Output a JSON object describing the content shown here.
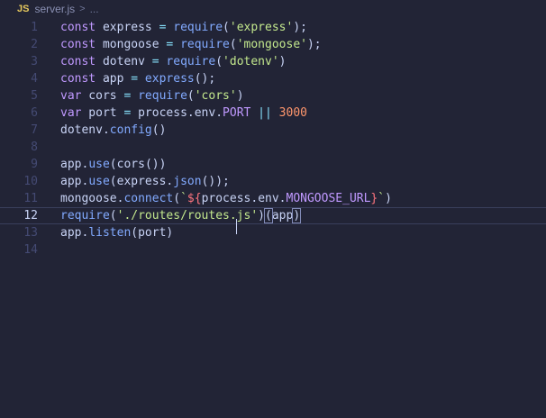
{
  "breadcrumb": {
    "lang_badge": "JS",
    "file": "server.js",
    "separator": ">",
    "more": "..."
  },
  "colors": {
    "background": "#222436",
    "keyword": "#c099ff",
    "function": "#82aaff",
    "string": "#c3e88d",
    "operator": "#86e1fc",
    "property": "#4fd6be",
    "number": "#ff966c",
    "line_number": "#444a73"
  },
  "editor": {
    "active_line": 12,
    "lines": [
      {
        "n": "1",
        "tokens": [
          [
            "kw",
            "const"
          ],
          [
            "var",
            " express "
          ],
          [
            "op",
            "="
          ],
          [
            "fn",
            " require"
          ],
          [
            "punc",
            "("
          ],
          [
            "str",
            "'express'"
          ],
          [
            "punc",
            ");"
          ]
        ]
      },
      {
        "n": "2",
        "tokens": [
          [
            "kw",
            "const"
          ],
          [
            "var",
            " mongoose "
          ],
          [
            "op",
            "="
          ],
          [
            "fn",
            " require"
          ],
          [
            "punc",
            "("
          ],
          [
            "str",
            "'mongoose'"
          ],
          [
            "punc",
            ");"
          ]
        ]
      },
      {
        "n": "3",
        "tokens": [
          [
            "kw",
            "const"
          ],
          [
            "var",
            " dotenv "
          ],
          [
            "op",
            "="
          ],
          [
            "fn",
            " require"
          ],
          [
            "punc",
            "("
          ],
          [
            "str",
            "'dotenv'"
          ],
          [
            "punc",
            ")"
          ]
        ]
      },
      {
        "n": "4",
        "tokens": [
          [
            "kw",
            "const"
          ],
          [
            "var",
            " app "
          ],
          [
            "op",
            "="
          ],
          [
            "fn",
            " express"
          ],
          [
            "punc",
            "();"
          ]
        ]
      },
      {
        "n": "5",
        "tokens": [
          [
            "kw",
            "var"
          ],
          [
            "var",
            " cors "
          ],
          [
            "op",
            "="
          ],
          [
            "fn",
            " require"
          ],
          [
            "punc",
            "("
          ],
          [
            "str",
            "'cors'"
          ],
          [
            "punc",
            ")"
          ]
        ]
      },
      {
        "n": "6",
        "tokens": [
          [
            "kw",
            "var"
          ],
          [
            "var",
            " port "
          ],
          [
            "op",
            "="
          ],
          [
            "var",
            " process"
          ],
          [
            "punc",
            "."
          ],
          [
            "var",
            "env"
          ],
          [
            "punc",
            "."
          ],
          [
            "const",
            "PORT"
          ],
          [
            "op",
            " ||"
          ],
          [
            "num",
            " 3000"
          ]
        ]
      },
      {
        "n": "7",
        "tokens": [
          [
            "var",
            "dotenv"
          ],
          [
            "punc",
            "."
          ],
          [
            "fn",
            "config"
          ],
          [
            "punc",
            "()"
          ]
        ]
      },
      {
        "n": "8",
        "tokens": []
      },
      {
        "n": "9",
        "tokens": [
          [
            "var",
            "app"
          ],
          [
            "punc",
            "."
          ],
          [
            "fn",
            "use"
          ],
          [
            "punc",
            "("
          ],
          [
            "var",
            "cors"
          ],
          [
            "punc",
            "())"
          ]
        ]
      },
      {
        "n": "10",
        "tokens": [
          [
            "var",
            "app"
          ],
          [
            "punc",
            "."
          ],
          [
            "fn",
            "use"
          ],
          [
            "punc",
            "("
          ],
          [
            "var",
            "express"
          ],
          [
            "punc",
            "."
          ],
          [
            "fn",
            "json"
          ],
          [
            "punc",
            "());"
          ]
        ]
      },
      {
        "n": "11",
        "tokens": [
          [
            "var",
            "mongoose"
          ],
          [
            "punc",
            "."
          ],
          [
            "fn",
            "connect"
          ],
          [
            "punc",
            "("
          ],
          [
            "str",
            "`"
          ],
          [
            "tmpl",
            "${"
          ],
          [
            "var",
            "process"
          ],
          [
            "punc",
            "."
          ],
          [
            "var",
            "env"
          ],
          [
            "punc",
            "."
          ],
          [
            "const",
            "MONGOOSE_URL"
          ],
          [
            "tmpl",
            "}"
          ],
          [
            "str",
            "`"
          ],
          [
            "punc",
            ")"
          ]
        ]
      },
      {
        "n": "12",
        "tokens": [
          [
            "fn",
            "require"
          ],
          [
            "punc",
            "("
          ],
          [
            "str",
            "'./routes/routes.js'"
          ],
          [
            "punc",
            ")"
          ],
          [
            "brk",
            "("
          ],
          [
            "var",
            "app"
          ],
          [
            "brk",
            ")"
          ]
        ]
      },
      {
        "n": "13",
        "tokens": [
          [
            "var",
            "app"
          ],
          [
            "punc",
            "."
          ],
          [
            "fn",
            "listen"
          ],
          [
            "punc",
            "("
          ],
          [
            "var",
            "port"
          ],
          [
            "punc",
            ")"
          ]
        ]
      },
      {
        "n": "14",
        "tokens": []
      }
    ]
  }
}
